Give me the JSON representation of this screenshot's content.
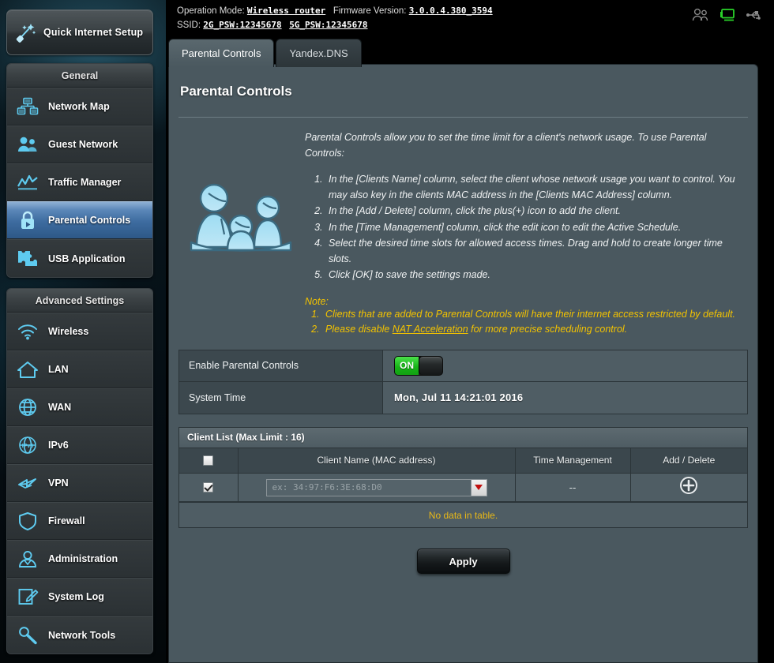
{
  "header": {
    "operation_mode_label": "Operation Mode:",
    "operation_mode_value": "Wireless router",
    "firmware_label": "Firmware Version:",
    "firmware_value": "3.0.0.4.380_3594",
    "ssid_label": "SSID:",
    "ssid_2g": "2G_PSW:12345678",
    "ssid_5g": "5G_PSW:12345678",
    "icons": [
      "users-icon",
      "connected-client-icon",
      "usb-icon"
    ],
    "client_icon_color": "#2ad42a"
  },
  "sidebar": {
    "quick_setup": {
      "label": "Quick Internet Setup",
      "icon": "magic-wand-icon"
    },
    "groups": [
      {
        "title": "General",
        "items": [
          {
            "label": "Network Map",
            "icon": "network-map-icon",
            "active": false
          },
          {
            "label": "Guest Network",
            "icon": "guest-network-icon",
            "active": false
          },
          {
            "label": "Traffic Manager",
            "icon": "traffic-manager-icon",
            "active": false
          },
          {
            "label": "Parental Controls",
            "icon": "parental-controls-icon",
            "active": true
          },
          {
            "label": "USB Application",
            "icon": "usb-application-icon",
            "active": false
          }
        ]
      },
      {
        "title": "Advanced Settings",
        "items": [
          {
            "label": "Wireless",
            "icon": "wireless-icon",
            "active": false
          },
          {
            "label": "LAN",
            "icon": "lan-home-icon",
            "active": false
          },
          {
            "label": "WAN",
            "icon": "wan-globe-icon",
            "active": false
          },
          {
            "label": "IPv6",
            "icon": "ipv6-globe-icon",
            "active": false
          },
          {
            "label": "VPN",
            "icon": "vpn-icon",
            "active": false
          },
          {
            "label": "Firewall",
            "icon": "firewall-shield-icon",
            "active": false
          },
          {
            "label": "Administration",
            "icon": "administration-icon",
            "active": false
          },
          {
            "label": "System Log",
            "icon": "system-log-icon",
            "active": false
          },
          {
            "label": "Network Tools",
            "icon": "network-tools-icon",
            "active": false
          }
        ]
      }
    ],
    "active_accent": "#3d6b9f",
    "icon_color": "#5ecbf0"
  },
  "tabs": [
    {
      "label": "Parental Controls",
      "active": true
    },
    {
      "label": "Yandex.DNS",
      "active": false
    }
  ],
  "page": {
    "title": "Parental Controls",
    "illustration": "family-icon",
    "intro": "Parental Controls allow you to set the time limit for a client's network usage. To use Parental Controls:",
    "steps": [
      "In the [Clients Name] column, select the client whose network usage you want to control. You may also key in the clients MAC address in the [Clients MAC Address] column.",
      "In the [Add / Delete] column, click the plus(+) icon to add the client.",
      "In the [Time Management] column, click the edit icon to edit the Active Schedule.",
      "Select the desired time slots for allowed access times. Drag and hold to create longer time slots.",
      "Click [OK] to save the settings made."
    ],
    "note_heading": "Note:",
    "notes_1": "Clients that are added to Parental Controls will have their internet access restricted by default.",
    "notes_2_pre": "Please disable ",
    "notes_2_link": "NAT Acceleration",
    "notes_2_post": " for more precise scheduling control.",
    "note_color": "#f2c200"
  },
  "settings": {
    "enable_label": "Enable Parental Controls",
    "enable_state": "ON",
    "enable_on_color": "#18b518",
    "system_time_label": "System Time",
    "system_time_value": "Mon, Jul 11 14:21:01 2016"
  },
  "client_list": {
    "caption": "Client List (Max Limit : 16)",
    "columns": [
      "",
      "Client Name (MAC address)",
      "Time Management",
      "Add / Delete"
    ],
    "row": {
      "checked": true,
      "mac_placeholder": "ex: 34:97:F6:3E:68:D0",
      "mac_value": "",
      "time_management": "--",
      "add_icon": "plus-circle-icon",
      "dropdown_icon": "dropdown-triangle-icon"
    },
    "header_checkbox_checked": false,
    "empty_message": "No data in table."
  },
  "footer": {
    "apply_label": "Apply"
  }
}
